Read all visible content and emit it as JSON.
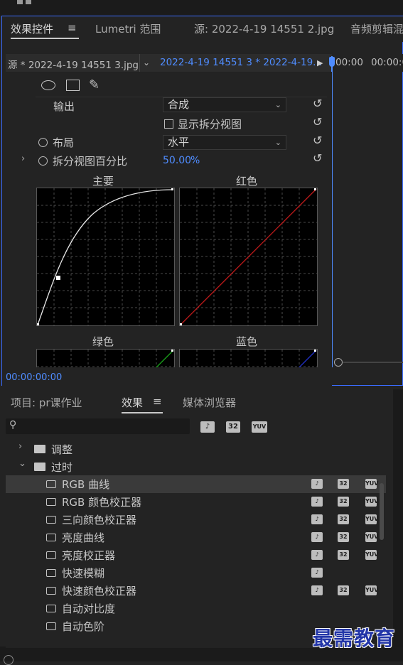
{
  "effect_controls": {
    "tabs": [
      {
        "label": "效果控件",
        "active": true
      },
      {
        "label": "Lumetri 范围",
        "active": false
      },
      {
        "label": "源: 2022-4-19 14551 2.jpg",
        "active": false
      },
      {
        "label": "音频剪辑混",
        "active": false
      }
    ],
    "source_label": "源 * 2022-4-19 14551 3.jpg",
    "sequence_label": "2022-4-19 14551 3 * 2022-4-19...",
    "ruler_times": [
      "00:00",
      "00:00:0"
    ],
    "output_label": "输出",
    "output_value": "合成",
    "split_view_label": "显示拆分视图",
    "layout_label": "布局",
    "layout_value": "水平",
    "split_percent_label": "拆分视图百分比",
    "split_percent_value": "50.00",
    "split_percent_unit": "%",
    "curves": {
      "master": "主要",
      "red": "红色",
      "green": "绿色",
      "blue": "蓝色"
    },
    "timecode": "00:00:00:00"
  },
  "effects_panel": {
    "tabs": [
      {
        "label": "项目: pr课作业",
        "active": false
      },
      {
        "label": "效果",
        "active": true
      },
      {
        "label": "媒体浏览器",
        "active": false
      }
    ],
    "badges": {
      "accel": "♪",
      "b32": "32",
      "yuv": "YUV"
    },
    "folders": [
      {
        "label": "调整",
        "expanded": false
      },
      {
        "label": "过时",
        "expanded": true
      }
    ],
    "items": [
      {
        "label": "RGB 曲线",
        "selected": true
      },
      {
        "label": "RGB 颜色校正器"
      },
      {
        "label": "三向颜色校正器"
      },
      {
        "label": "亮度曲线"
      },
      {
        "label": "亮度校正器"
      },
      {
        "label": "快速模糊"
      },
      {
        "label": "快速颜色校正器"
      },
      {
        "label": "自动对比度"
      },
      {
        "label": "自动色阶"
      }
    ]
  },
  "watermark": "最需教育",
  "colors": {
    "accent": "#3b6cff",
    "timecode": "#4f8cff",
    "link_blue": "#4f8cff"
  }
}
